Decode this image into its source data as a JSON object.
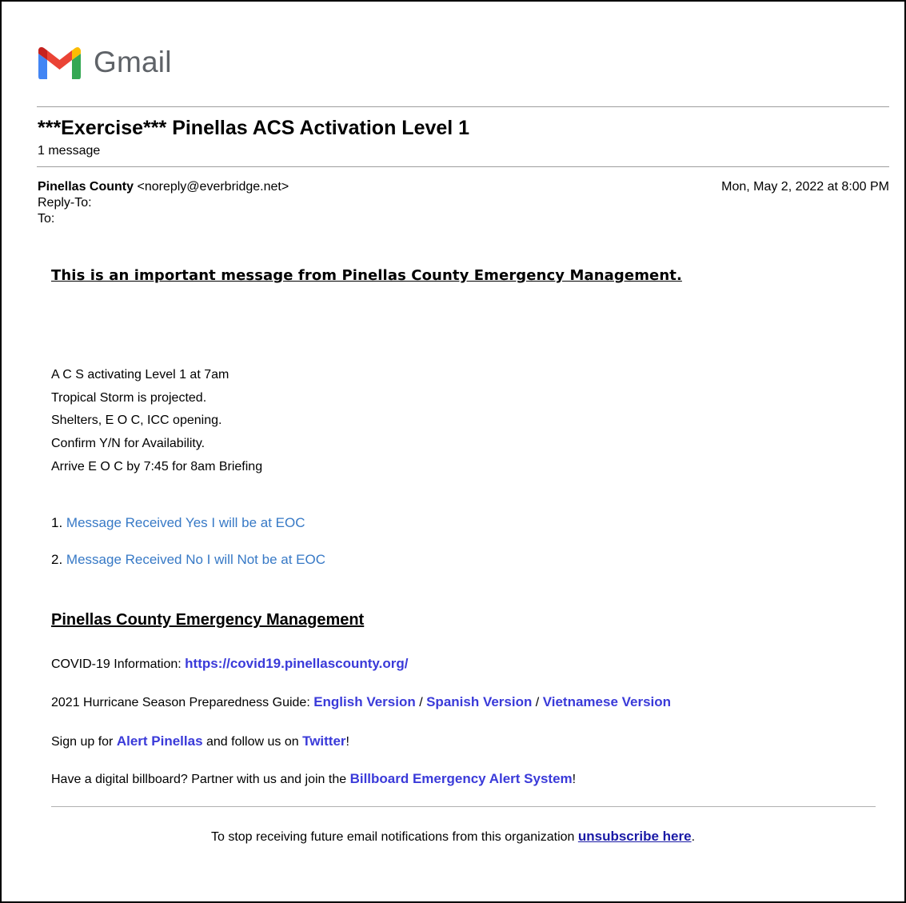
{
  "brand": {
    "logo_icon": "gmail-m-icon",
    "name": "Gmail",
    "colors": {
      "blue": "#4285f4",
      "red": "#ea4335",
      "yellow": "#fbbc04",
      "green": "#34a853",
      "darkred": "#c5221f"
    }
  },
  "thread": {
    "subject": "***Exercise*** Pinellas ACS Activation Level 1",
    "count": "1 message"
  },
  "message": {
    "sender_name": "Pinellas County",
    "sender_email": "<noreply@everbridge.net>",
    "date": "Mon, May 2, 2022 at 8:00 PM",
    "reply_to_label": "Reply-To:",
    "to_label": "To:"
  },
  "body": {
    "important": "This is an important message from Pinellas County Emergency Management.",
    "lines": [
      "A C S activating Level 1 at 7am",
      "Tropical Storm is projected.",
      "Shelters, E O C, ICC opening.",
      "Confirm Y/N for Availability.",
      "Arrive E O C by 7:45 for 8am Briefing"
    ],
    "options": [
      {
        "num": "1.",
        "label": "Message Received Yes I will be at EOC"
      },
      {
        "num": "2.",
        "label": "Message Received No I will Not be at EOC"
      }
    ]
  },
  "footer": {
    "org_title": "Pinellas County Emergency Management",
    "covid_label": "COVID-19 Information: ",
    "covid_link": "https://covid19.pinellascounty.org/",
    "guide_label": "2021 Hurricane Season Preparedness Guide: ",
    "guide_english": "English Version",
    "guide_sep1": " / ",
    "guide_spanish": "Spanish Version",
    "guide_sep2": " / ",
    "guide_vietnamese": "Vietnamese Version",
    "signup_pre": "Sign up for ",
    "signup_link": "Alert Pinellas",
    "signup_mid": " and follow us on ",
    "twitter_link": "Twitter",
    "signup_end": "!",
    "billboard_pre": "Have a digital billboard? Partner with us and join the ",
    "billboard_link": "Billboard Emergency Alert System",
    "billboard_end": "!",
    "unsub_pre": "To stop receiving future email notifications from this organization ",
    "unsub_link": "unsubscribe here",
    "unsub_end": "."
  }
}
